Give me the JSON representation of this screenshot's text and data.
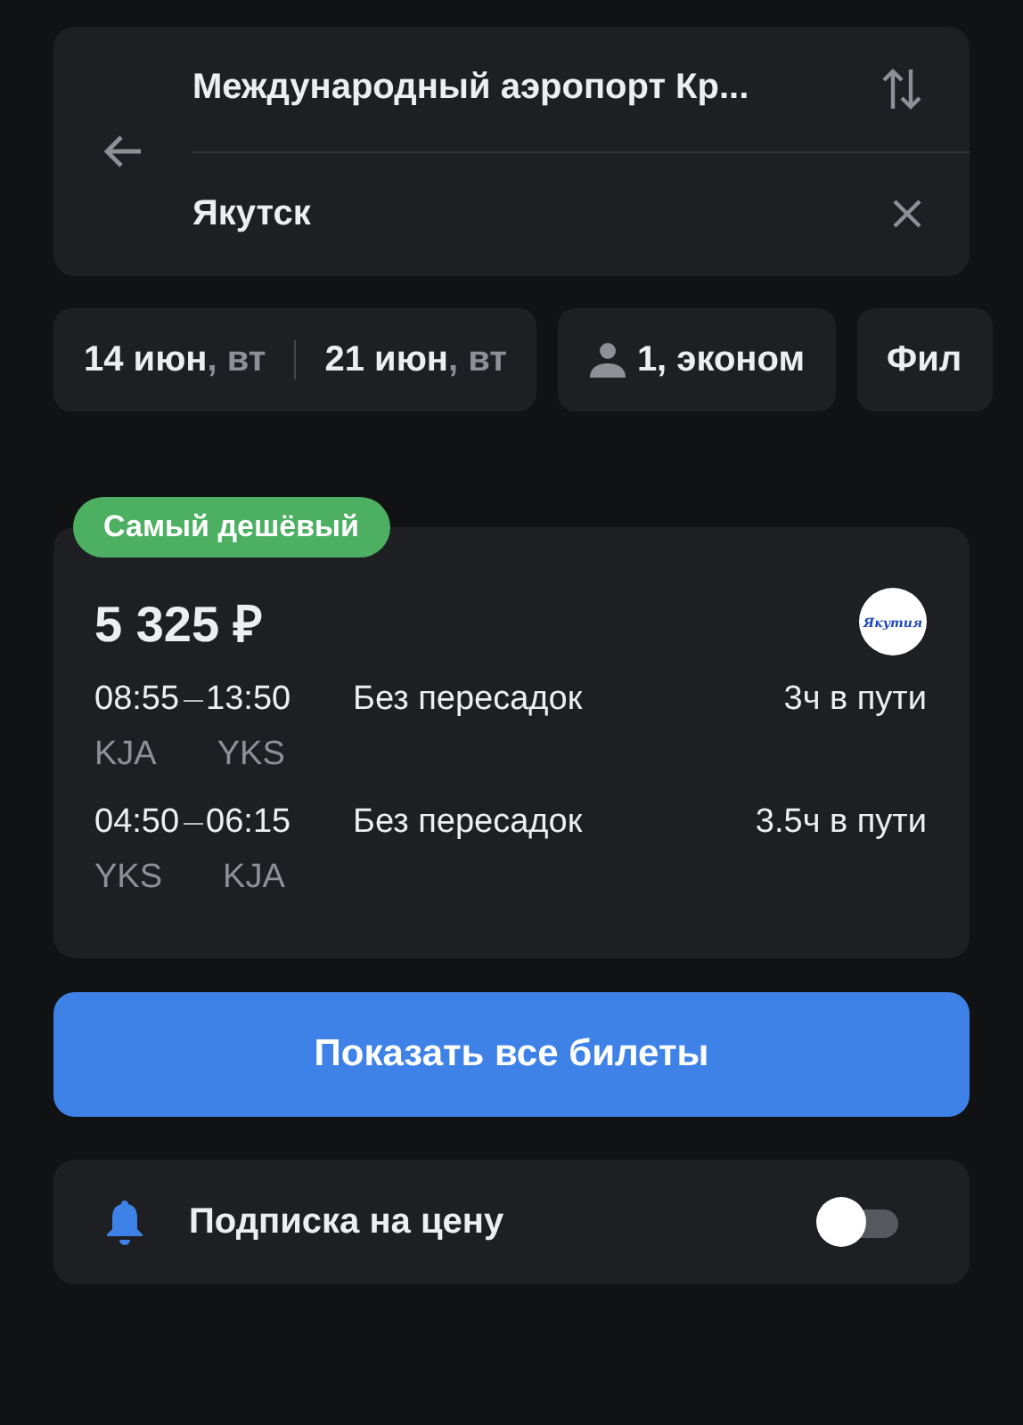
{
  "route": {
    "origin": "Международный аэропорт Кр...",
    "destination": "Якутск"
  },
  "chips": [
    {
      "kind": "dates",
      "depart": "14 июн",
      "depart_day": ", вт",
      "return": "21 июн",
      "return_day": ", вт"
    },
    {
      "kind": "passengers",
      "label": "1, эконом"
    },
    {
      "kind": "filter",
      "label": "Фил"
    }
  ],
  "offer": {
    "badge": "Самый дешёвый",
    "price": "5 325 ₽",
    "airline_logo": "Якутия",
    "legs": [
      {
        "depart": "08:55",
        "arrive": "13:50",
        "from": "KJA",
        "to": "YKS",
        "stops": "Без пересадок",
        "duration": "3ч в пути"
      },
      {
        "depart": "04:50",
        "arrive": "06:15",
        "from": "YKS",
        "to": "KJA",
        "stops": "Без пересадок",
        "duration": "3.5ч в пути"
      }
    ]
  },
  "show_all_button": "Показать все билеты",
  "price_alert": {
    "label": "Подписка на цену",
    "on": false
  }
}
